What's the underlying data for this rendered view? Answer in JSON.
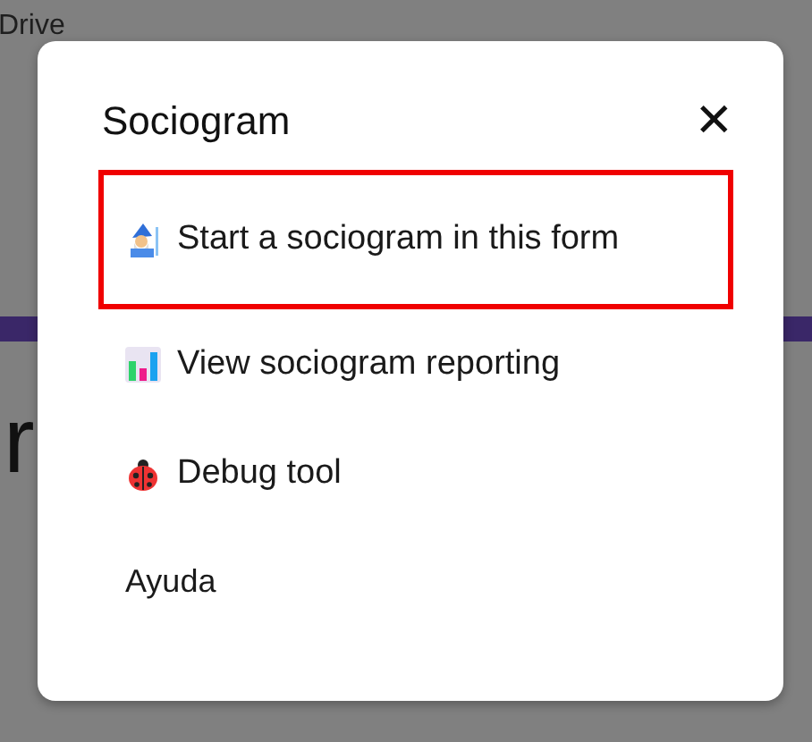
{
  "background": {
    "title": "Drive",
    "heading_fragment": "r"
  },
  "dialog": {
    "title": "Sociogram",
    "close": "✕",
    "items": [
      {
        "label": "Start a sociogram in this form",
        "kind": "wizard",
        "highlighted": true
      },
      {
        "label": "View sociogram reporting",
        "kind": "chart",
        "highlighted": false
      },
      {
        "label": "Debug tool",
        "kind": "bug",
        "highlighted": false
      },
      {
        "label": "Ayuda",
        "kind": "plain",
        "highlighted": false
      }
    ]
  }
}
